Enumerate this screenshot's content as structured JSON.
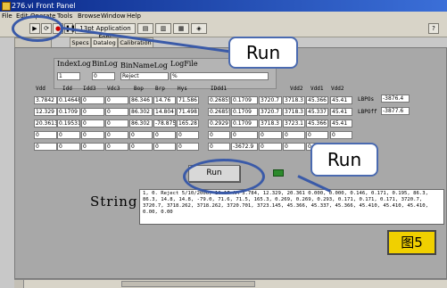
{
  "window": {
    "title": "276.vi Front Panel"
  },
  "menu": [
    "File",
    "Edit",
    "Operate",
    "Tools",
    "Browse",
    "Window",
    "Help"
  ],
  "toolbar": {
    "font_label": "13pt Application Font"
  },
  "tabs": [
    "Datalog",
    "Specs",
    "Datalog",
    "Calibration"
  ],
  "logbox": {
    "headers": [
      "IndexLog",
      "BinLog",
      "BinNameLog",
      "LogFile"
    ],
    "values": [
      "1",
      "0",
      "Reject",
      "%"
    ]
  },
  "table": {
    "headers": [
      "Vdd",
      "Idd",
      "Idd3",
      "Vdc3",
      "Bop",
      "Brp",
      "Hys",
      "IDdd1",
      "",
      "",
      "Vdd2",
      "Vdd1",
      "Vdd2"
    ],
    "rows": [
      [
        "3.7842",
        "0.14648",
        "0",
        "0",
        "86.346",
        "14.76",
        "71.586",
        "0.26855",
        "0.1709",
        "3720.7",
        "3718.3",
        "45.366",
        "45.41"
      ],
      [
        "12.329",
        "0.1709",
        "0",
        "0",
        "86.302",
        "14.804",
        "71.498",
        "0.26855",
        "0.1709",
        "3720.7",
        "3718.3",
        "45.337",
        "45.41"
      ],
      [
        "20.3613",
        "0.19531",
        "0",
        "0",
        "86.302",
        "-78.875",
        "165.28",
        "0.29297",
        "0.1709",
        "3718.3",
        "3723.1",
        "45.366",
        "45.41"
      ],
      [
        "0",
        "0",
        "0",
        "0",
        "0",
        "0",
        "0",
        "0",
        "0",
        "0",
        "0",
        "0",
        "0"
      ],
      [
        "0",
        "0",
        "0",
        "0",
        "0",
        "0",
        "0",
        "0",
        "-3672.9",
        "0",
        "0",
        "0",
        "0"
      ]
    ]
  },
  "side": {
    "lbpos_label": "LBPOs",
    "lbpos_value": "-3876.4",
    "lbpoff_label": "LBPOff",
    "lbpoff_value": "-3877.6"
  },
  "run_button": "Run",
  "callouts": [
    "Run",
    "Run"
  ],
  "string": {
    "label": "String",
    "text": "1,     0. Reject  5/10/2006, 10:17 AM  3.784, 12.329, 20.361  0.000,  0.000,  0.146,  0.171,  0.195,  86.3,  86.3,  14.8,  14.8,  -79.0,  71.6,  71.5,  165.3,  0.269,  0.269,  0.293,  0.171,  0.171,  0.171,  3720.7,  3720.7,  3718.262,  3718.262,  3720.701,  3723.145,  45.366,  45.337,  45.366,  45.410,  45.410,  45.410,  0.00,  0.00"
  },
  "figure_label": "图5"
}
